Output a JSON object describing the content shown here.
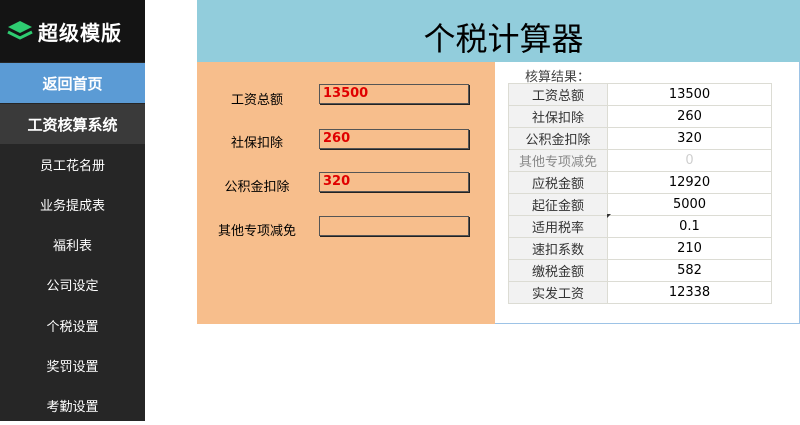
{
  "app": {
    "logo_text": "超级模版"
  },
  "sidebar": {
    "home_label": "返回首页",
    "system_label": "工资核算系统",
    "items": [
      {
        "label": "员工花名册"
      },
      {
        "label": "业务提成表"
      },
      {
        "label": "福利表"
      },
      {
        "label": "公司设定"
      },
      {
        "label": "个税设置"
      },
      {
        "label": "奖罚设置"
      },
      {
        "label": "考勤设置"
      }
    ]
  },
  "header": {
    "title": "个税计算器"
  },
  "form": {
    "salary": {
      "label": "工资总额",
      "value": "13500"
    },
    "social_security": {
      "label": "社保扣除",
      "value": "260"
    },
    "housing_fund": {
      "label": "公积金扣除",
      "value": "320"
    },
    "other_deduction": {
      "label": "其他专项减免",
      "value": ""
    }
  },
  "results": {
    "caption": "核算结果：",
    "rows": [
      {
        "label": "工资总额",
        "value": "13500"
      },
      {
        "label": "社保扣除",
        "value": "260"
      },
      {
        "label": "公积金扣除",
        "value": "320"
      },
      {
        "label": "其他专项减免",
        "value": "0"
      },
      {
        "label": "应税金额",
        "value": "12920"
      },
      {
        "label": "起征金额",
        "value": "5000"
      },
      {
        "label": "适用税率",
        "value": "0.1"
      },
      {
        "label": "速扣系数",
        "value": "210"
      },
      {
        "label": "缴税金额",
        "value": "582"
      },
      {
        "label": "实发工资",
        "value": "12338"
      }
    ]
  },
  "colors": {
    "sidebar_bg": "#262626",
    "logo_bg": "#141414",
    "home_button_bg": "#5b9bd5",
    "header_bg": "#92cddc",
    "form_panel_bg": "#f7be8c",
    "input_value_color": "#e00000",
    "logo_icon_color": "#2ecc71"
  },
  "icons": {
    "logo": "stacked-layers-icon"
  }
}
